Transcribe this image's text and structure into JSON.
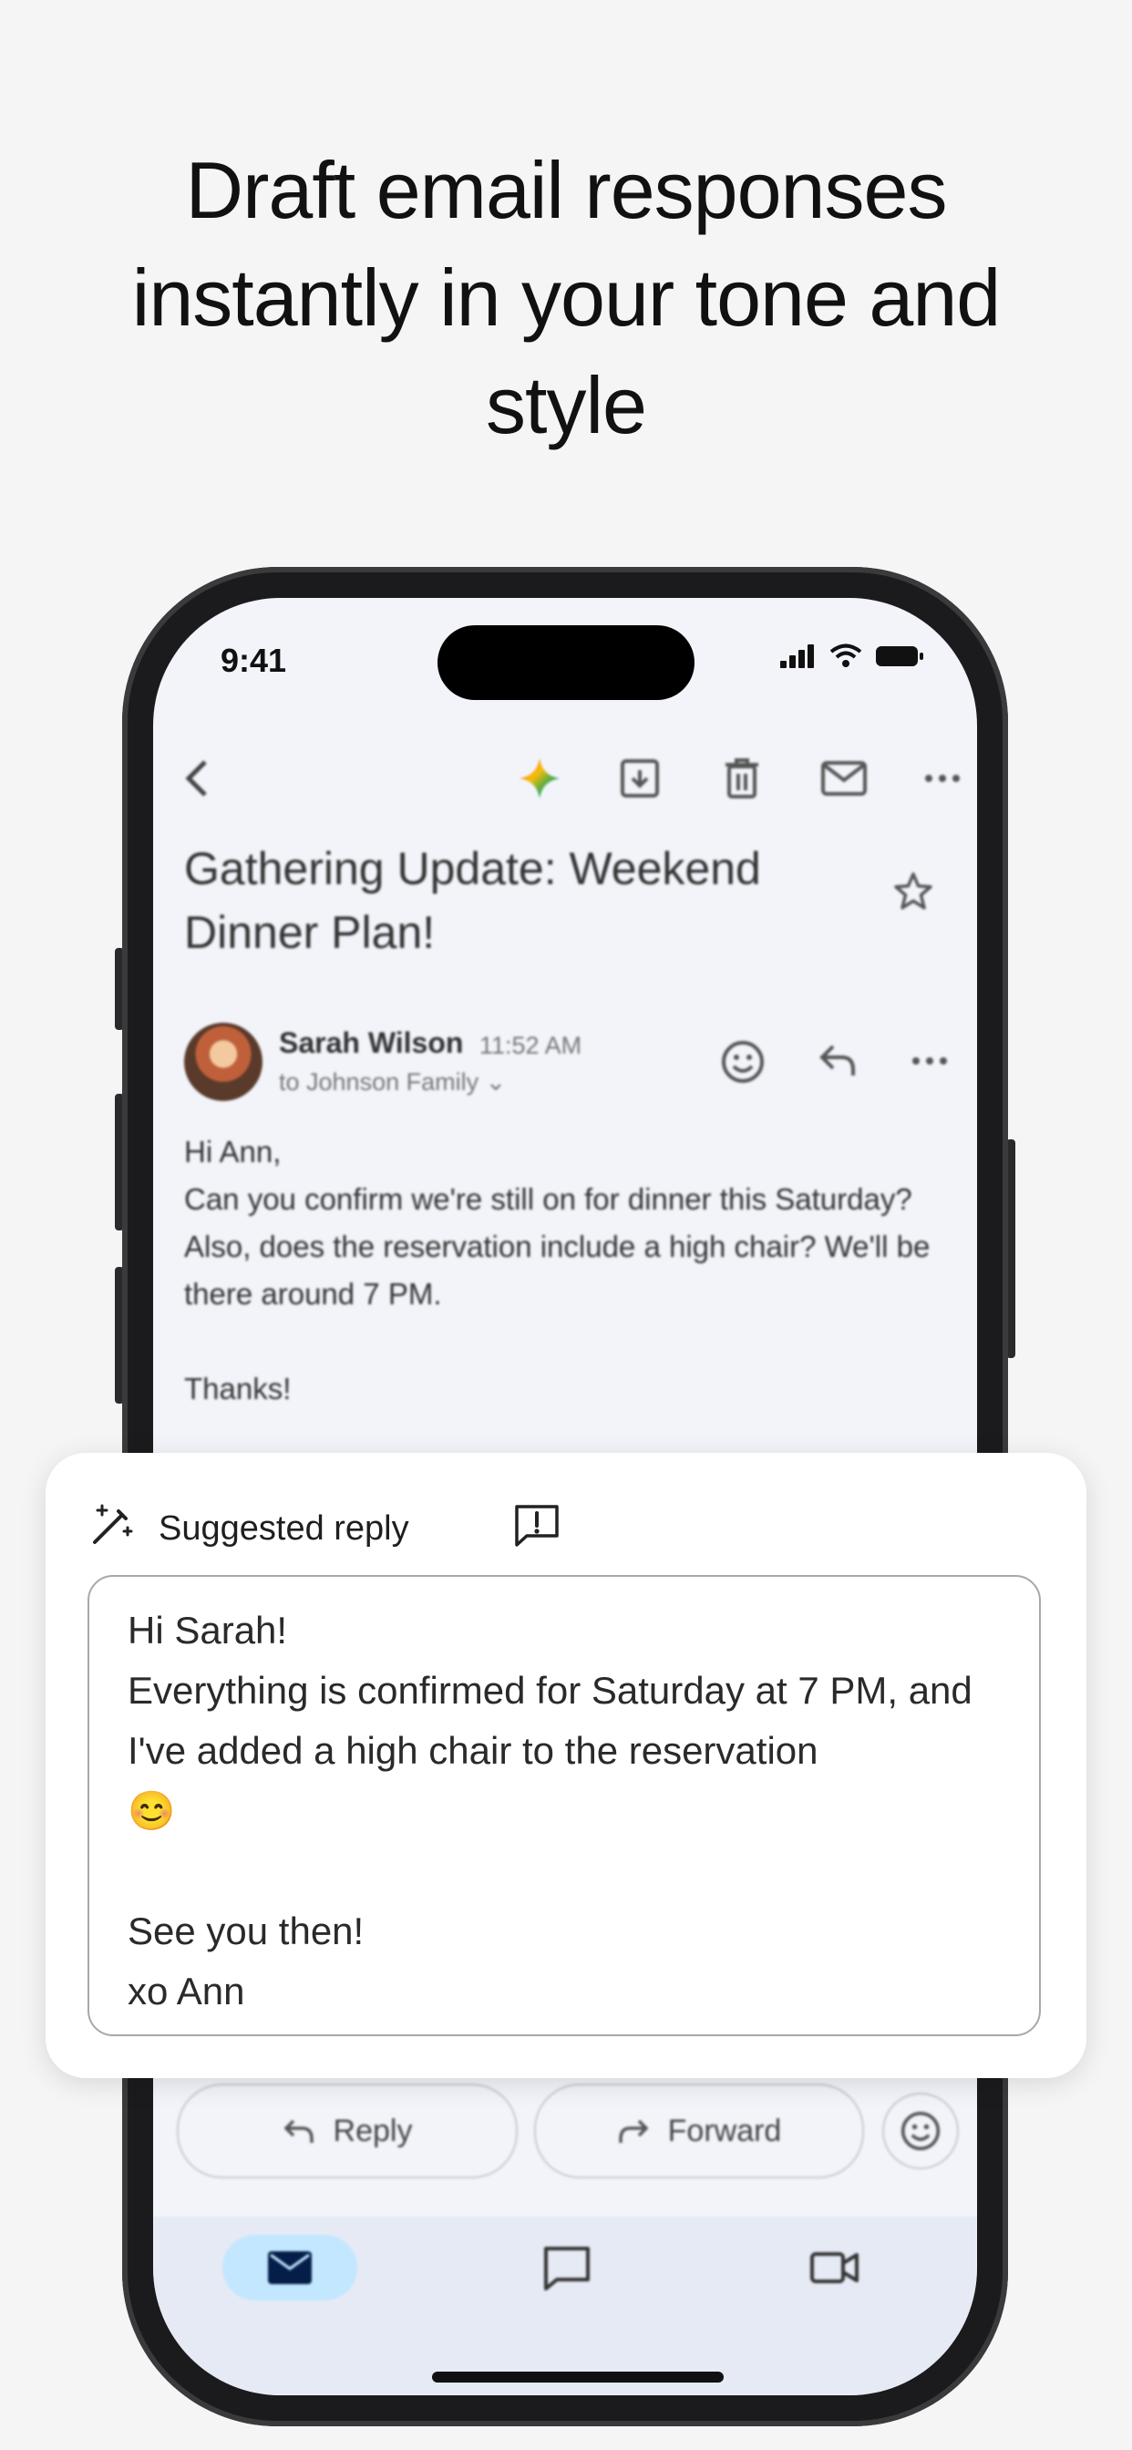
{
  "headline": "Draft email responses instantly in your tone and style",
  "status_bar": {
    "time": "9:41"
  },
  "email": {
    "subject": "Gathering Update: Weekend Dinner Plan!",
    "sender": "Sarah Wilson",
    "time": "11:52 AM",
    "recipients": "to Johnson Family",
    "body": "Hi Ann,\nCan you confirm we're still on for dinner this Saturday? Also, does the reservation include a high chair? We'll be there around 7 PM.\n\nThanks!"
  },
  "suggested_reply": {
    "title": "Suggested reply",
    "text": "Hi Sarah!\nEverything is confirmed for Saturday at 7 PM, and I've added a high chair to the reservation\n😊\n\nSee you then!\nxo Ann"
  },
  "actions": {
    "reply": "Reply",
    "forward": "Forward"
  },
  "colors": {
    "accent": "#0b57d0",
    "nav_active": "#c2e7ff",
    "gemini": "#4285f4"
  }
}
